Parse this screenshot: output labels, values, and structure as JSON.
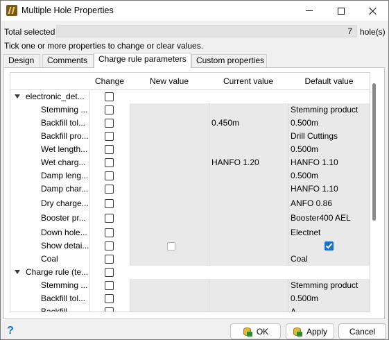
{
  "window": {
    "title": "Multiple Hole Properties"
  },
  "summary": {
    "total_label": "Total selected",
    "total_value": "7",
    "total_unit": "hole(s)",
    "instruction": "Tick one or more properties to change or clear values."
  },
  "tabs": [
    {
      "label": "Design",
      "active": false
    },
    {
      "label": "Comments",
      "active": false
    },
    {
      "label": "Charge rule parameters",
      "active": true
    },
    {
      "label": "Custom properties",
      "active": false
    }
  ],
  "grid": {
    "headers": {
      "change": "Change",
      "new_value": "New value",
      "current_value": "Current value",
      "default_value": "Default value"
    },
    "groups": [
      {
        "name": "electronic_det...",
        "rows": [
          {
            "name": "Stemming ...",
            "current": "",
            "default": "Stemming product"
          },
          {
            "name": "Backfill tol...",
            "current": "0.450m",
            "default": "0.500m"
          },
          {
            "name": "Backfill pro...",
            "current": "",
            "default": "Drill Cuttings"
          },
          {
            "name": "Wet length...",
            "current": "",
            "default": "0.500m"
          },
          {
            "name": "Wet charg...",
            "current": "HANFO 1.20",
            "default": "HANFO 1.10"
          },
          {
            "name": "Damp leng...",
            "current": "",
            "default": "0.500m"
          },
          {
            "name": "Damp char...",
            "current": "",
            "default": "HANFO 1.10"
          },
          {
            "name": "Dry charge...",
            "current": "",
            "default": "ANFO 0.86"
          },
          {
            "name": "Booster pr...",
            "current": "",
            "default": "Booster400 AEL"
          },
          {
            "name": "Down hole...",
            "current": "",
            "default": "Electnet"
          },
          {
            "name": "Show detai...",
            "current": "",
            "default": "",
            "new_checkbox": true,
            "default_checked": true
          },
          {
            "name": "Coal",
            "current": "",
            "default": "Coal"
          }
        ]
      },
      {
        "name": "Charge rule (te...",
        "rows": [
          {
            "name": "Stemming ...",
            "current": "",
            "default": "Stemming product"
          },
          {
            "name": "Backfill tol...",
            "current": "",
            "default": "0.500m"
          },
          {
            "name": "Backfill...",
            "current": "",
            "default": "A..."
          }
        ]
      }
    ]
  },
  "buttons": {
    "ok": "OK",
    "apply": "Apply",
    "cancel": "Cancel"
  },
  "colors": {
    "accent": "#1a6fc9",
    "shade": "#e9e9e9"
  },
  "icons": [
    "app-icon",
    "minimize-icon",
    "maximize-icon",
    "close-icon",
    "expand-arrow-icon",
    "database-icon",
    "help-icon"
  ]
}
